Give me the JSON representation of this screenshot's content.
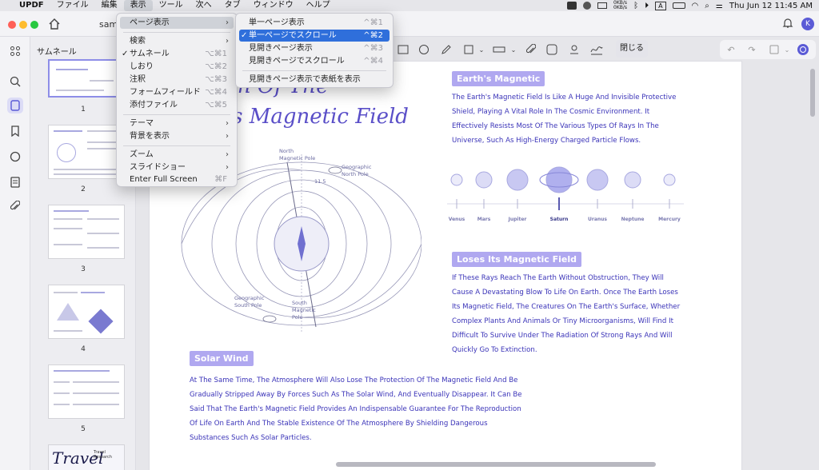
{
  "menubar": {
    "apple": "",
    "app": "UPDF",
    "items": [
      "ファイル",
      "編集",
      "表示",
      "ツール",
      "次へ",
      "タブ",
      "ウィンドウ",
      "ヘルプ"
    ],
    "net_up": "0KB/s",
    "net_down": "0KB/s",
    "input": "A",
    "clock": "Thu Jun 12  11:45 AM"
  },
  "titlebar": {
    "tab_title": "samp"
  },
  "account": {
    "initial": "K"
  },
  "thumbnails": {
    "title": "サムネール",
    "pages": [
      "1",
      "2",
      "3",
      "4",
      "5"
    ],
    "last_thumb_text": "Travel",
    "last_thumb_caption": "Travel Research"
  },
  "toolbar": {
    "close_label": "閉じる"
  },
  "view_menu": {
    "items": [
      {
        "label": "ページ表示",
        "shortcut": "",
        "arrow": "›"
      },
      {
        "label": "検索",
        "shortcut": "",
        "arrow": "›"
      },
      {
        "label": "サムネール",
        "shortcut": "⌥⌘1",
        "check": "✓"
      },
      {
        "label": "しおり",
        "shortcut": "⌥⌘2"
      },
      {
        "label": "注釈",
        "shortcut": "⌥⌘3"
      },
      {
        "label": "フォームフィールド",
        "shortcut": "⌥⌘4"
      },
      {
        "label": "添付ファイル",
        "shortcut": "⌥⌘5"
      },
      {
        "label": "テーマ",
        "shortcut": "",
        "arrow": "›"
      },
      {
        "label": "背景を表示",
        "shortcut": "",
        "arrow": "›"
      },
      {
        "label": "ズーム",
        "shortcut": "",
        "arrow": "›"
      },
      {
        "label": "スライドショー",
        "shortcut": "",
        "arrow": "›"
      },
      {
        "label": "Enter Full Screen",
        "shortcut": "⌘F"
      }
    ]
  },
  "page_display_menu": {
    "items": [
      {
        "label": "単一ページ表示",
        "shortcut": "^⌘1"
      },
      {
        "label": "単一ページでスクロール",
        "shortcut": "^⌘2",
        "check": "✓"
      },
      {
        "label": "見開きページ表示",
        "shortcut": "^⌘3"
      },
      {
        "label": "見開きページでスクロール",
        "shortcut": "^⌘4"
      },
      {
        "label": "見開きページ表示で表紙を表示",
        "shortcut": ""
      }
    ]
  },
  "document": {
    "title_line1": "ation Of The",
    "title_line2": "'s Magnetic Field",
    "diagram_labels": {
      "north_magnetic": "North\nMagnetic Pole",
      "geo_north": "Geographic\nNorth Pole",
      "geo_south": "Geographic\nSouth Pole",
      "south_magnetic": "South\nMagnetic\nPole",
      "angle": "11.5"
    },
    "sections": {
      "earths_magnetic": {
        "heading": "Earth's Magnetic",
        "body": "The Earth's Magnetic Field Is Like A Huge And Invisible Protective Shield, Playing A Vital Role In The Cosmic Environment. It Effectively Resists Most Of The Various Types Of Rays In The Universe, Such As High-Energy Charged Particle Flows."
      },
      "loses": {
        "heading": "Loses Its Magnetic Field",
        "body": "If These Rays Reach The Earth Without Obstruction, They Will Cause A Devastating Blow To Life On Earth. Once The Earth Loses Its Magnetic Field, The Creatures On The Earth's Surface, Whether Complex Plants And Animals Or Tiny Microorganisms, Will Find It Difficult To Survive Under The Radiation Of Strong Rays And Will Quickly Go To Extinction."
      },
      "solar_wind": {
        "heading": "Solar Wind",
        "body": "At The Same Time, The Atmosphere Will Also Lose The Protection Of The Magnetic Field And Be Gradually Stripped Away By Forces Such As The Solar Wind, And Eventually Disappear. It Can Be Said That The Earth's Magnetic Field Provides An Indispensable Guarantee For The Reproduction Of Life On Earth And The Stable Existence Of The Atmosphere By Shielding Dangerous Substances Such As Solar Particles."
      }
    },
    "planets": [
      "Venus",
      "Mars",
      "Jupiter",
      "Saturn",
      "Uranus",
      "Neptune",
      "Mercury"
    ]
  },
  "colors": {
    "accent": "#5b5bd6",
    "heading_bg": "#b0a8f0",
    "text": "#3a33b8",
    "menu_select": "#2f6fdb"
  }
}
